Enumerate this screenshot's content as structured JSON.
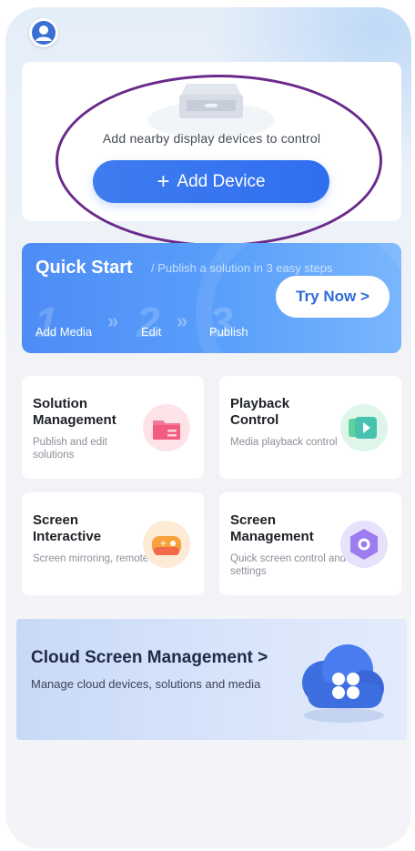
{
  "device_card": {
    "prompt": "Add nearby display devices to control",
    "add_button_label": "Add Device"
  },
  "quick_start": {
    "title": "Quick Start",
    "subtitle": "/ Publish a solution in 3 easy steps",
    "steps": [
      {
        "num": "1",
        "label": "Add Media"
      },
      {
        "num": "2",
        "label": "Edit"
      },
      {
        "num": "3",
        "label": "Publish"
      }
    ],
    "try_button_label": "Try Now >"
  },
  "features": [
    {
      "title": "Solution Management",
      "desc": "Publish and edit solutions",
      "icon": "folder-icon"
    },
    {
      "title": "Playback Control",
      "desc": "Media playback control",
      "icon": "play-icon"
    },
    {
      "title": "Screen Interactive",
      "desc": "Screen mirroring, remote",
      "icon": "gamepad-icon"
    },
    {
      "title": "Screen Management",
      "desc": "Quick screen control and settings",
      "icon": "hexagon-settings-icon"
    }
  ],
  "cloud": {
    "title": "Cloud Screen Management  >",
    "desc": "Manage cloud devices, solutions and media"
  },
  "colors": {
    "accent_blue": "#3f7cf0",
    "annotation_purple": "#6a2a8c"
  }
}
